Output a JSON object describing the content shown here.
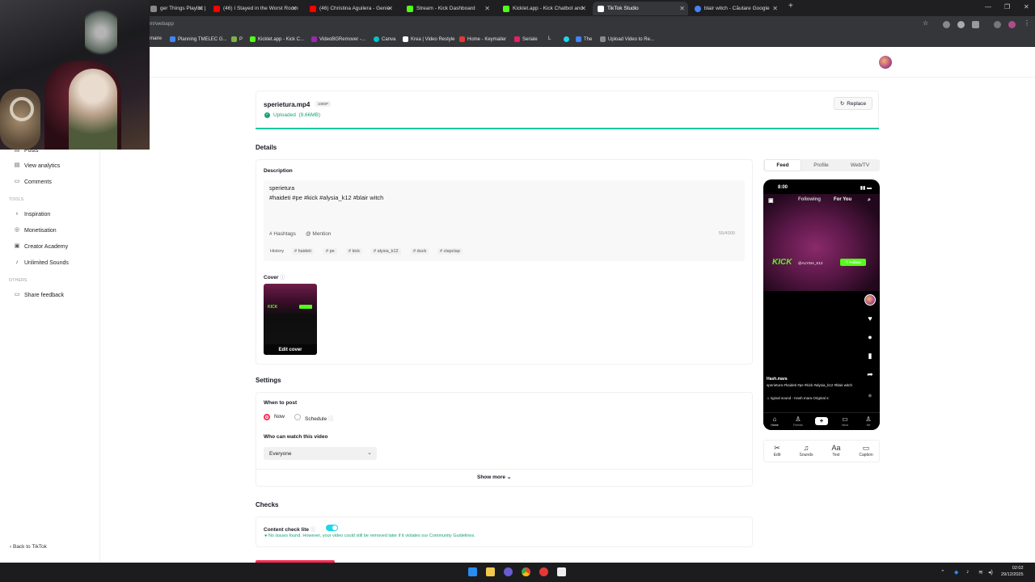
{
  "browser": {
    "tabs": [
      {
        "label": "ger Things Playlist |",
        "color": "#888"
      },
      {
        "label": "(46) I Stayed in the Worst Room",
        "color": "#ff0000"
      },
      {
        "label": "(46) Christina Aguilera - Genie",
        "color": "#ff0000"
      },
      {
        "label": "Stream - Kick Dashboard",
        "color": "#53fc18"
      },
      {
        "label": "Kicklet.app - Kick Chatbot and",
        "color": "#53fc18"
      },
      {
        "label": "TikTok Studio",
        "color": "#ffffff"
      },
      {
        "label": "blair witch - Căutare Google",
        "color": "#4285f4"
      }
    ],
    "url": "m/webapp",
    "bookmarks": [
      {
        "label": "maire",
        "color": "#888"
      },
      {
        "label": "Planning TMELEC G...",
        "color": "#4285f4"
      },
      {
        "label": "P",
        "color": "#7cb342"
      },
      {
        "label": "Kicklet.app - Kick C...",
        "color": "#53fc18"
      },
      {
        "label": "VideoBGRemover -...",
        "color": "#9c27b0"
      },
      {
        "label": "Canva",
        "color": "#00c4cc"
      },
      {
        "label": "Krea | Video Restyle",
        "color": "#ffffff"
      },
      {
        "label": "Home - Keymailer",
        "color": "#e53935"
      },
      {
        "label": "Seriale",
        "color": "#e91e63"
      },
      {
        "label": "L",
        "color": "#888"
      },
      {
        "label": "The",
        "color": "#4285f4"
      },
      {
        "label": "Upload Video to Re...",
        "color": "#888"
      }
    ]
  },
  "sidebar": {
    "items_top": [
      {
        "label": "Posts",
        "icon": "posts-icon"
      },
      {
        "label": "View analytics",
        "icon": "analytics-icon"
      },
      {
        "label": "Comments",
        "icon": "comments-icon"
      }
    ],
    "tools_header": "TOOLS",
    "tools": [
      {
        "label": "Inspiration",
        "icon": "bulb-icon"
      },
      {
        "label": "Monetisation",
        "icon": "money-icon"
      },
      {
        "label": "Creator Academy",
        "icon": "academy-icon"
      },
      {
        "label": "Unlimited Sounds",
        "icon": "music-icon"
      }
    ],
    "others_header": "OTHERS",
    "others": [
      {
        "label": "Share feedback",
        "icon": "feedback-icon"
      }
    ],
    "back": "Back to TikTok"
  },
  "upload": {
    "filename": "sperietura.mp4",
    "resolution": "1080P",
    "status": "Uploaded",
    "size": "(9.66MB)",
    "replace": "Replace",
    "progress": 1.0
  },
  "details": {
    "header": "Details",
    "description_label": "Description",
    "description_line1": "sperietura",
    "description_line2": "#haideti  #pe  #kick  #alysia_k12  #blair witch",
    "hashtags_btn": "Hashtags",
    "mention_btn": "Mention",
    "counter": "55/4000",
    "history_label": "History",
    "history_chips": [
      "# haideti",
      "# pe",
      "# kick",
      "# alysia_k12",
      "# duck",
      "# clapclap"
    ],
    "cover_label": "Cover",
    "edit_cover": "Edit cover"
  },
  "settings": {
    "header": "Settings",
    "when_label": "When to post",
    "now": "Now",
    "schedule": "Schedule",
    "who_label": "Who can watch this video",
    "who_value": "Everyone",
    "show_more": "Show more"
  },
  "checks": {
    "header": "Checks",
    "content_check": "Content check lite",
    "enabled": true,
    "message": "No issues found. However, your video could still be removed later if it violates our Community Guidelines."
  },
  "preview": {
    "tabs": [
      "Feed",
      "Profile",
      "Web/TV"
    ],
    "active_tab": "Feed",
    "time": "8:00",
    "following": "Following",
    "foryou": "For You",
    "kick": "KICK",
    "channel": "@ALYSIA_K12",
    "follow": "Follow",
    "username": "Hash.mara",
    "caption": "sperietura #haideti #pe #kick #alysia_k12 #blair witch",
    "sound": "♫ riginal sound - Hash.mara    Original s:",
    "nav": [
      "Home",
      "Friends",
      "Inbox",
      "Me"
    ]
  },
  "edit_tools": [
    "Edit",
    "Sounds",
    "Text",
    "Caption"
  ],
  "taskbar": {
    "time": "02:02",
    "date": "29/12/2025"
  },
  "colors": {
    "accent": "#fe2c55",
    "success": "#1aa179",
    "progress": "#1ac9a0",
    "kick_green": "#53fc18"
  }
}
